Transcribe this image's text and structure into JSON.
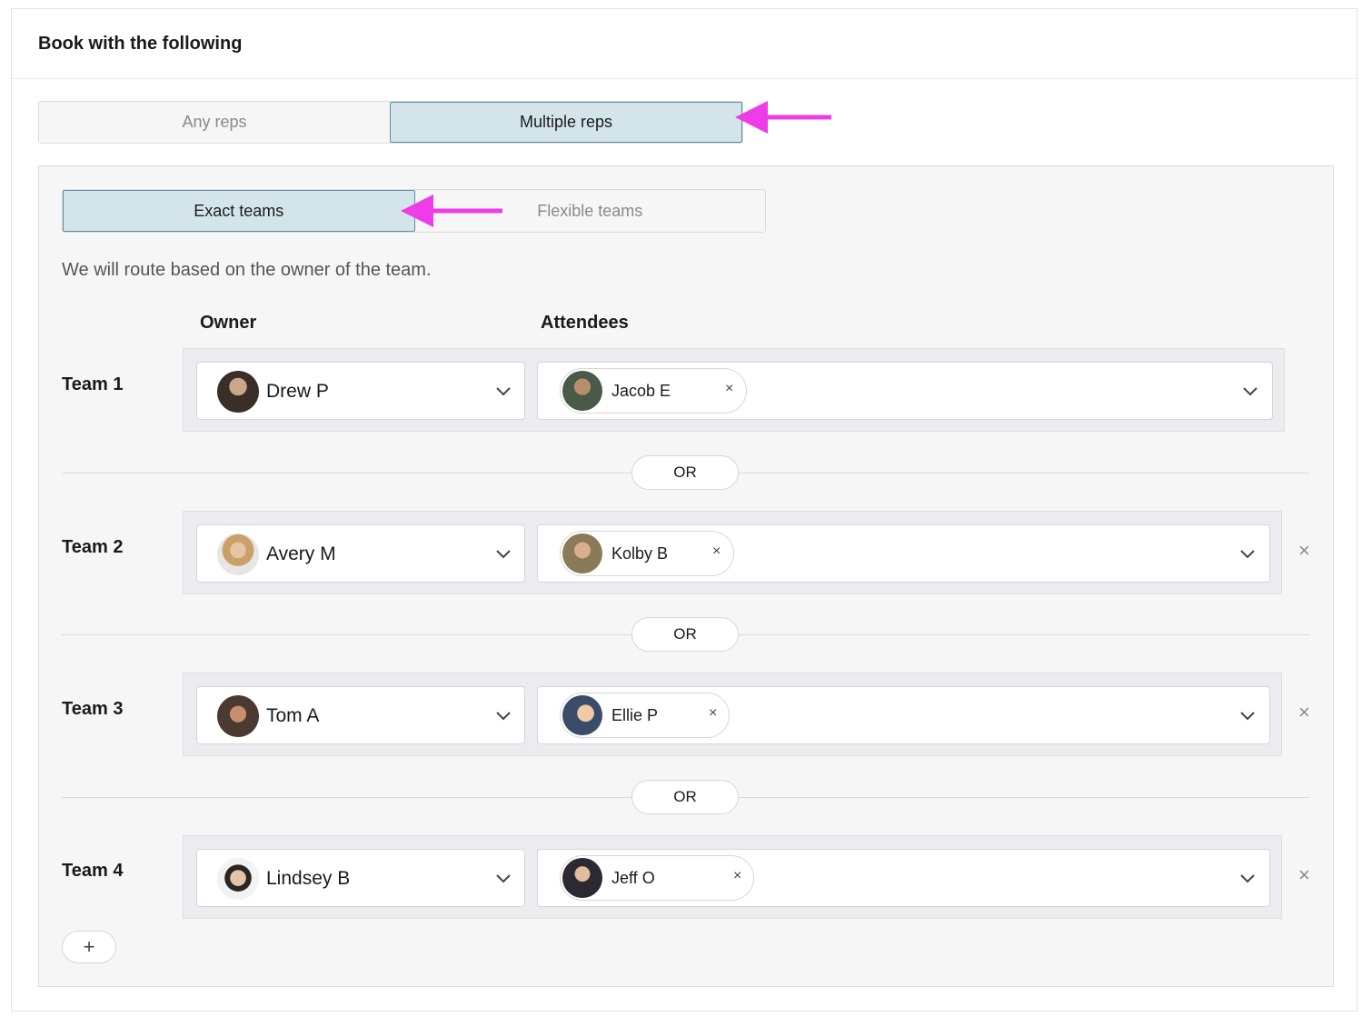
{
  "card": {
    "title": "Book with the following"
  },
  "rep_mode": {
    "options": [
      "Any reps",
      "Multiple reps"
    ],
    "selected": "Multiple reps"
  },
  "team_mode": {
    "options": [
      "Exact teams",
      "Flexible teams"
    ],
    "selected": "Exact teams"
  },
  "description": "We will route based on the owner of the team.",
  "columns": {
    "owner": "Owner",
    "attendees": "Attendees"
  },
  "teams": [
    {
      "label": "Team 1",
      "owner": "Drew P",
      "attendee": "Jacob E",
      "removable": false
    },
    {
      "label": "Team 2",
      "owner": "Avery M",
      "attendee": "Kolby B",
      "removable": true
    },
    {
      "label": "Team 3",
      "owner": "Tom A",
      "attendee": "Ellie P",
      "removable": true
    },
    {
      "label": "Team 4",
      "owner": "Lindsey B",
      "attendee": "Jeff O",
      "removable": true
    }
  ],
  "separator_label": "OR",
  "add_button_label": "+",
  "remove_icon": "×",
  "chip_remove_icon": "×",
  "colors": {
    "selected_bg": "#d3e5ea",
    "selected_border": "#5a8fa0",
    "annotation_arrow": "#ee3ce8"
  },
  "icons": [
    "chevron-down-icon",
    "close-icon",
    "plus-icon",
    "arrow-annotation"
  ]
}
